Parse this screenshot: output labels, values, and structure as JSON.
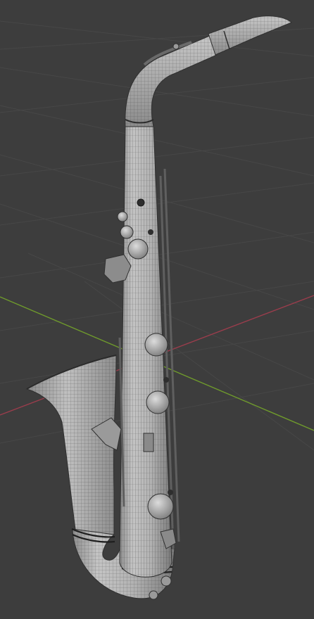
{
  "viewport": {
    "background": "#3d3d3d",
    "grid_color": "#474747",
    "x_axis_color": "#9a3d4c",
    "y_axis_color": "#6f9a2c"
  },
  "model": {
    "subject": "saxophone",
    "display": "wireframe-over-solid",
    "base_color": "#b9b9b9",
    "wire_color": "#2b2b2b"
  }
}
